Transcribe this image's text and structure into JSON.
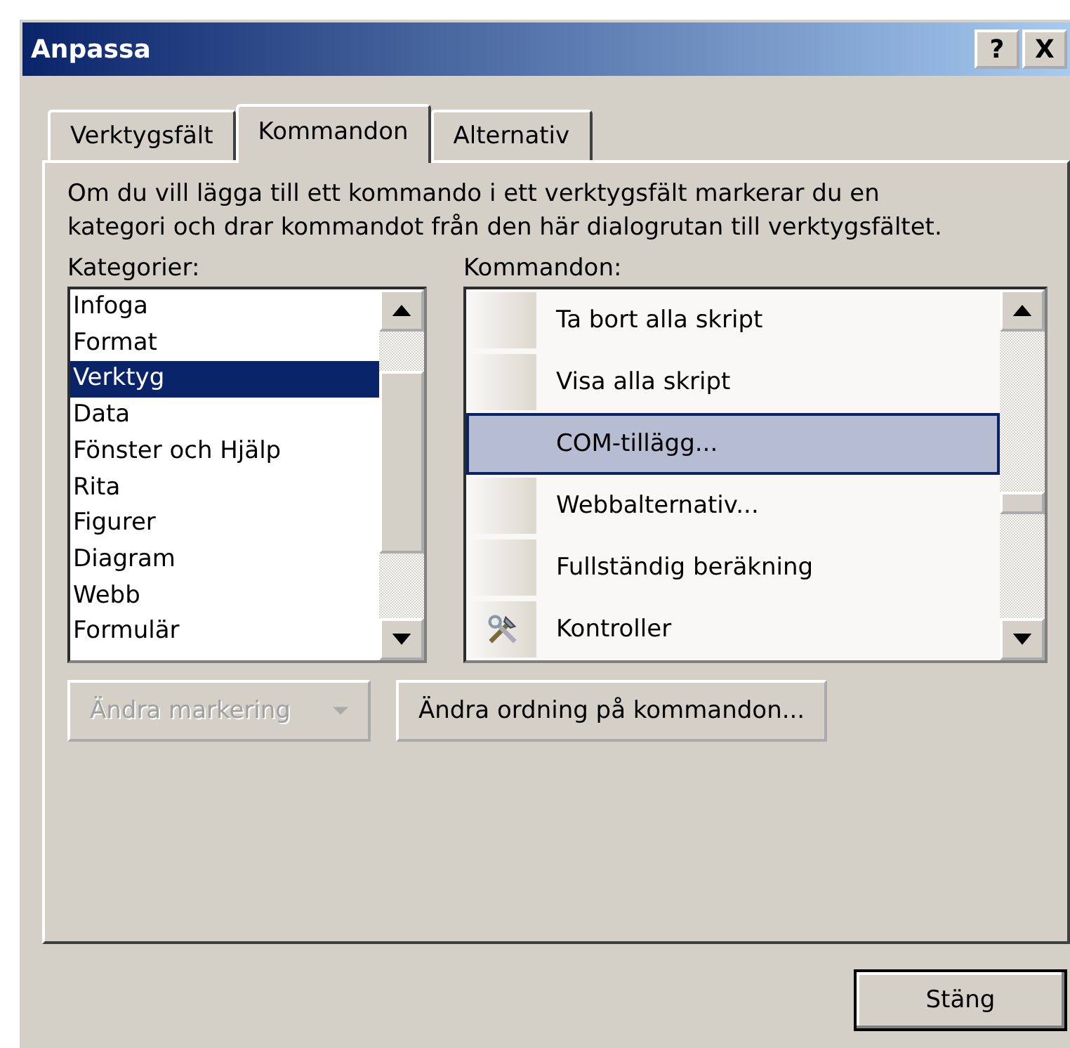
{
  "window": {
    "title": "Anpassa",
    "help_button": "?",
    "close_button": "X"
  },
  "tabs": [
    {
      "label": "Verktygsfält",
      "selected": false
    },
    {
      "label": "Kommandon",
      "selected": true
    },
    {
      "label": "Alternativ",
      "selected": false
    }
  ],
  "description": "Om du vill lägga till ett kommando i ett verktygsfält markerar du en kategori och drar kommandot från den här dialogrutan till verktygsfältet.",
  "categories": {
    "label": "Kategorier:",
    "items": [
      {
        "label": "Infoga",
        "selected": false
      },
      {
        "label": "Format",
        "selected": false
      },
      {
        "label": "Verktyg",
        "selected": true
      },
      {
        "label": "Data",
        "selected": false
      },
      {
        "label": "Fönster och Hjälp",
        "selected": false
      },
      {
        "label": "Rita",
        "selected": false
      },
      {
        "label": "Figurer",
        "selected": false
      },
      {
        "label": "Diagram",
        "selected": false
      },
      {
        "label": "Webb",
        "selected": false
      },
      {
        "label": "Formulär",
        "selected": false
      }
    ]
  },
  "commands": {
    "label": "Kommandon:",
    "items": [
      {
        "label": "Ta bort alla skript",
        "selected": false,
        "kind": "plain"
      },
      {
        "label": "Visa alla skript",
        "selected": false,
        "kind": "plain"
      },
      {
        "label": "COM-tillägg...",
        "selected": true,
        "kind": "plain"
      },
      {
        "label": "Webbalternativ...",
        "selected": false,
        "kind": "plain"
      },
      {
        "label": "Fullständig beräkning",
        "selected": false,
        "kind": "plain"
      },
      {
        "label": "Kontroller",
        "selected": false,
        "kind": "tool"
      }
    ]
  },
  "modify_selection": {
    "label": "Ändra markering",
    "disabled": true
  },
  "rearrange_button": "Ändra ordning på kommandon...",
  "close_dialog_button": "Stäng"
}
